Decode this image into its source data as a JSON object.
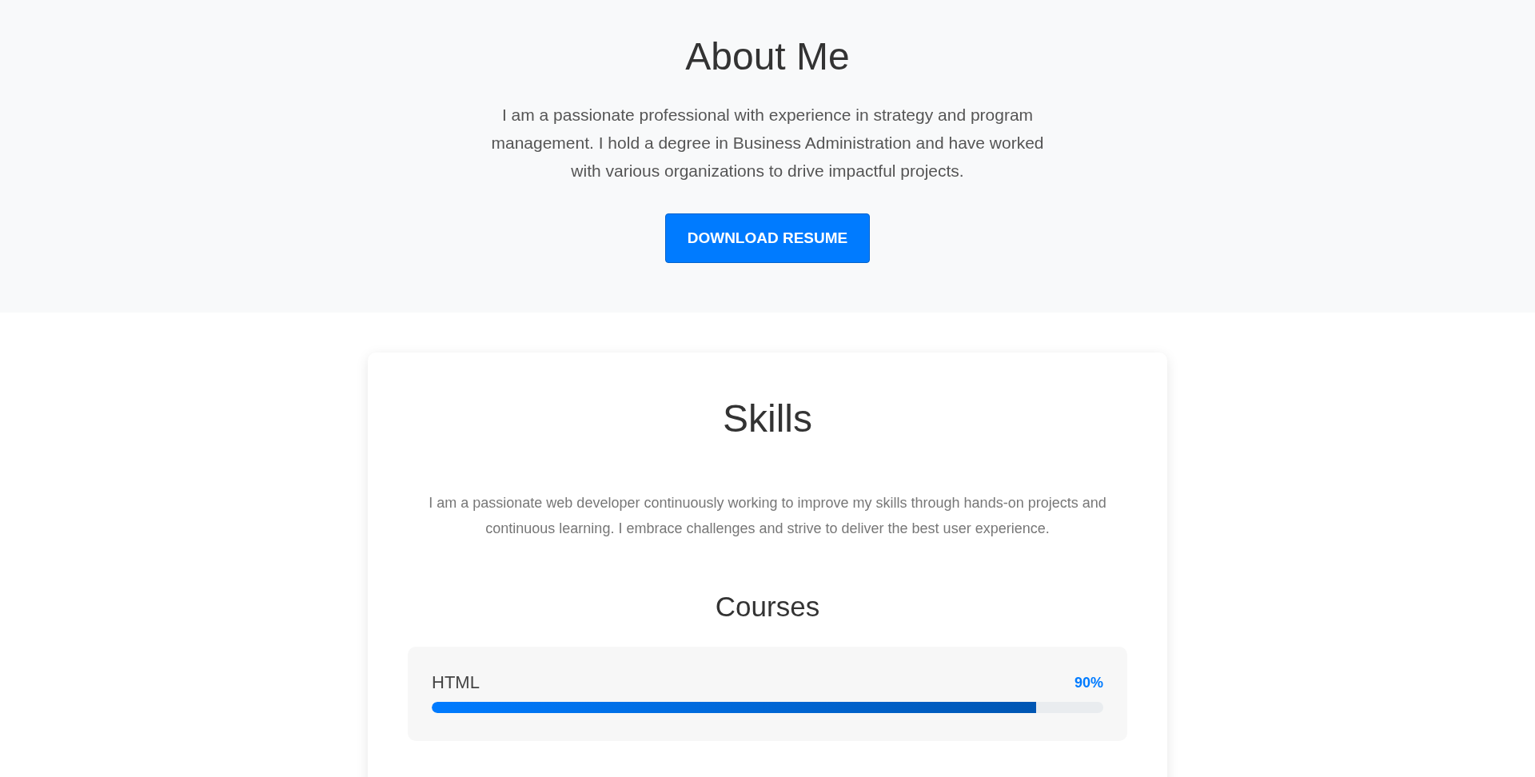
{
  "about": {
    "title": "About Me",
    "text": "I am a passionate professional with experience in strategy and program management. I hold a degree in Business Administration and have worked with various organizations to drive impactful projects.",
    "button": "DOWNLOAD RESUME"
  },
  "skills": {
    "title": "Skills",
    "text": "I am a passionate web developer continuously working to improve my skills through hands-on projects and continuous learning. I embrace challenges and strive to deliver the best user experience.",
    "courses_title": "Courses",
    "courses": [
      {
        "name": "HTML",
        "reading": "90%",
        "level": 0.9
      }
    ]
  }
}
